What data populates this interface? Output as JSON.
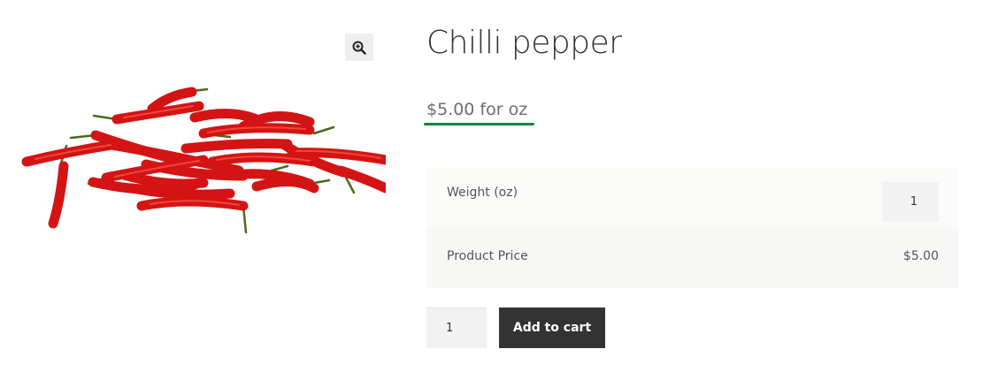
{
  "product": {
    "title": "Chilli pepper",
    "price": "$5.00 for oz",
    "image_alt": "Red chilli peppers"
  },
  "icons": {
    "zoom": "zoom-in-icon"
  },
  "colors": {
    "price_underline": "#0e8a3a",
    "button_bg": "#333333"
  },
  "addons": {
    "weight": {
      "label": "Weight (oz)",
      "value": "1"
    },
    "product_price": {
      "label": "Product Price",
      "value": "$5.00"
    }
  },
  "cart": {
    "quantity": "1",
    "add_label": "Add to cart"
  }
}
